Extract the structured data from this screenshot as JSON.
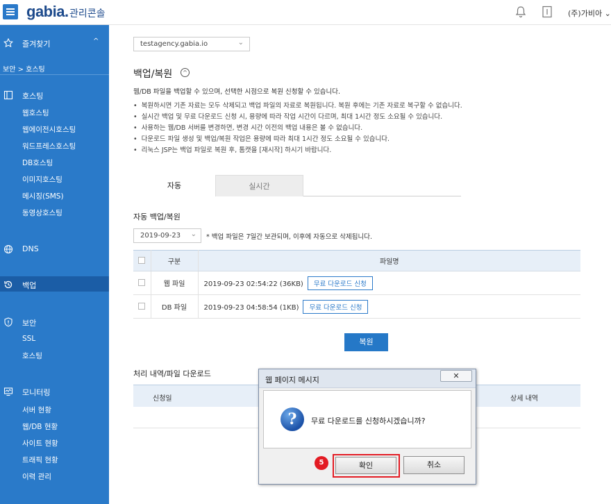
{
  "header": {
    "logo": "gabia.",
    "console": "관리콘솔",
    "user": "(주)가비아"
  },
  "sidebar": {
    "favorites": "즐겨찾기",
    "breadcrumb": "보안 > 호스팅",
    "hosting": {
      "label": "호스팅",
      "items": [
        "웹호스팅",
        "웹에이전시호스팅",
        "워드프레스호스팅",
        "DB호스팅",
        "이미지호스팅",
        "메시징(SMS)",
        "동영상호스팅"
      ]
    },
    "dns": "DNS",
    "backup": "백업",
    "security": {
      "label": "보안",
      "items": [
        "SSL",
        "호스팅"
      ]
    },
    "monitoring": {
      "label": "모니터링",
      "items": [
        "서버 현황",
        "웹/DB 현황",
        "사이트 현황",
        "트래픽 현황",
        "이력 관리"
      ]
    }
  },
  "main": {
    "domain_select": "testagency.gabia.io",
    "title": "백업/복원",
    "description": "웹/DB 파일을 백업할 수 있으며, 선택한 시점으로 복원 신청할 수 있습니다.",
    "bullets": [
      "복원하시면 기존 자료는 모두 삭제되고 백업 파일의 자료로 복원됩니다. 복원 후에는 기존 자료로 복구할 수 없습니다.",
      "실시간 백업 및 무료 다운로드 신청 시, 용량에 따라 작업 시간이 다르며, 최대 1시간 정도 소요될 수 있습니다.",
      "사용하는 웹/DB 서버를 변경하면, 변경 시간 이전의 백업 내용은 볼 수 없습니다.",
      "다운로드 파일 생성 및 백업/복원 작업은 용량에 따라 최대 1시간 정도 소요될 수 있습니다.",
      "리눅스 JSP는 백업 파일로 복원 후, 톰캣을 [재시작] 하시기 바랍니다."
    ],
    "tabs": [
      "자동",
      "실시간"
    ],
    "auto_section_title": "자동 백업/복원",
    "date": "2019-09-23",
    "date_note": "* 백업 파일은 7일간 보관되며, 이후에 자동으로 삭제됩니다.",
    "table": {
      "headers": [
        "구분",
        "파일명"
      ],
      "rows": [
        {
          "type": "웹 파일",
          "file": "2019-09-23 02:54:22 (36KB)",
          "action": "무료 다운로드 신청"
        },
        {
          "type": "DB 파일",
          "file": "2019-09-23 04:58:54 (1KB)",
          "action": "무료 다운로드 신청"
        }
      ]
    },
    "restore_button": "복원",
    "history_title": "처리 내역/파일 다운로드",
    "history_headers": [
      "신청일",
      "상세 내역"
    ]
  },
  "dialog": {
    "title": "웹 페이지 메시지",
    "message": "무료 다운로드를 신청하시겠습니까?",
    "ok": "확인",
    "cancel": "취소",
    "step_number": "5"
  }
}
